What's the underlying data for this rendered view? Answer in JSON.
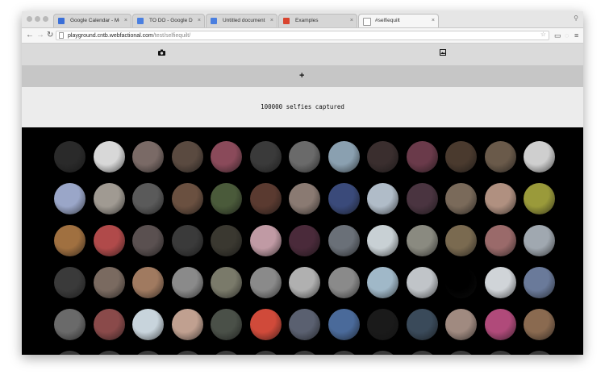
{
  "browser": {
    "tabs": [
      {
        "title": "Google Calendar - Month",
        "favicon_color": "#3a6fd8"
      },
      {
        "title": "TO DO - Google Docs",
        "favicon_color": "#4a7fe0"
      },
      {
        "title": "Untitled document - Goog",
        "favicon_color": "#4a7fe0"
      },
      {
        "title": "Examples",
        "favicon_color": "#d9442f"
      },
      {
        "title": "#selfiequilt",
        "favicon_color": "#ffffff"
      }
    ],
    "active_tab": 4,
    "tab_close": "×",
    "url_host": "playground.cntb.webfactional.com",
    "url_path": "/test/selfiequilt/",
    "icons": [
      "back-icon",
      "forward-icon",
      "reload-icon",
      "star-icon",
      "extension-icon",
      "menu-icon",
      "profile-icon"
    ]
  },
  "nav": {
    "camera_icon": "camera-icon",
    "gallery_icon": "image-icon",
    "add_icon": "plus-icon",
    "add_glyph": "+"
  },
  "banner": {
    "count": "100000",
    "label": "selfies captured",
    "text": "100000 selfies captured"
  },
  "quilt": {
    "columns": 13,
    "visible_rows": 5,
    "colors": [
      "#2a2a2a",
      "#d8d8d8",
      "#7a6a66",
      "#5a4a40",
      "#8a4a5a",
      "#3a3a3a",
      "#6a6a6a",
      "#8aa0b0",
      "#3a2e2e",
      "#6a3a4a",
      "#4a3a2e",
      "#6a5a4a",
      "#cfcfcf",
      "#9aa6c8",
      "#a09a92",
      "#5a5a5a",
      "#6a5040",
      "#4a5a3a",
      "#5a3a30",
      "#8a7a72",
      "#3a4a7a",
      "#b0bcc8",
      "#4a3440",
      "#7a6a5a",
      "#b09080",
      "#9a9a3a",
      "#a07040",
      "#b04a4a",
      "#5a5050",
      "#3a3a3a",
      "#3a3830",
      "#c09aa4",
      "#4a2a3a",
      "#6a7078",
      "#c8d0d4",
      "#8a8a80",
      "#7a6a50",
      "#9a6a6a",
      "#a0a8b0",
      "#3a3a3a",
      "#7a6a60",
      "#a07a60",
      "#8a8a8a",
      "#7a7a6a",
      "#8a8a8a",
      "#b0b0b0",
      "#8a8a8a",
      "#a0b8c8",
      "#c0c4c8",
      "#000000",
      "#d0d4d8",
      "#6a7a9a",
      "#6a6a6a",
      "#8a4a4a",
      "#c8d4dc",
      "#c0a090",
      "#4a5048",
      "#d04a3a",
      "#5a6070",
      "#4a6a9a",
      "#1a1a1a",
      "#3a4a5a",
      "#a08a80",
      "#b04a7a",
      "#8a6a50"
    ]
  }
}
